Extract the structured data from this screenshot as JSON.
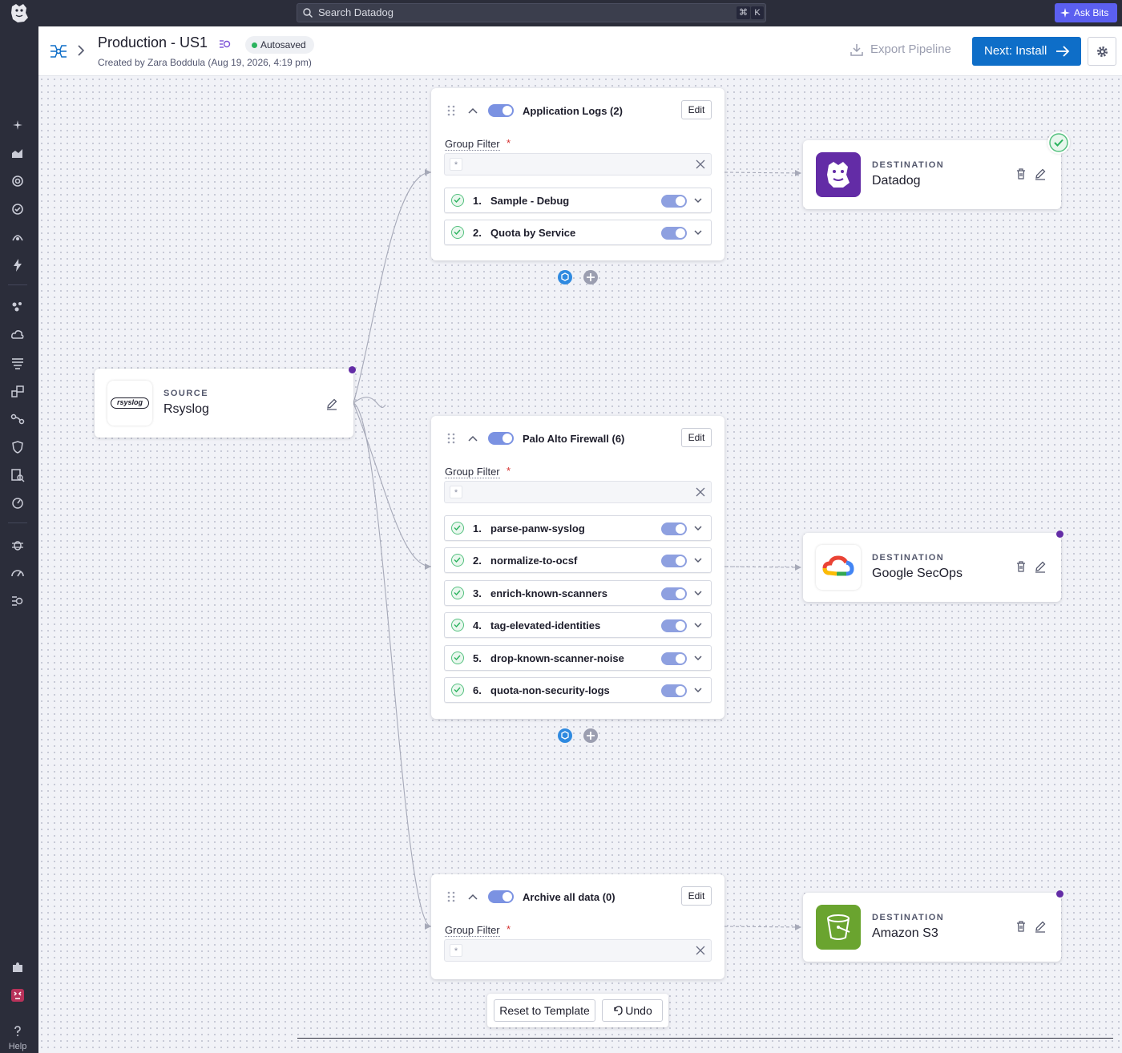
{
  "topbar": {
    "search_placeholder": "Search Datadog",
    "shortcut_cmd": "⌘",
    "shortcut_key": "K",
    "ask_bits": "Ask Bits"
  },
  "sidebar": {
    "help_label": "Help"
  },
  "header": {
    "title": "Production - US1",
    "status": "Autosaved",
    "created": "Created by Zara Boddula (Aug 19, 2026, 4:19 pm)",
    "export": "Export Pipeline",
    "next": "Next: Install"
  },
  "source": {
    "eyebrow": "SOURCE",
    "name": "Rsyslog",
    "logo_text": "rsyslog"
  },
  "groups": [
    {
      "title": "Application Logs (2)",
      "edit": "Edit",
      "filter_label": "Group Filter",
      "required": "*",
      "filter_value": "*",
      "processors": [
        {
          "num": "1.",
          "name": "Sample - Debug"
        },
        {
          "num": "2.",
          "name": "Quota by Service"
        }
      ]
    },
    {
      "title": "Palo Alto Firewall (6)",
      "edit": "Edit",
      "filter_label": "Group Filter",
      "required": "*",
      "filter_value": "*",
      "processors": [
        {
          "num": "1.",
          "name": "parse-panw-syslog"
        },
        {
          "num": "2.",
          "name": "normalize-to-ocsf"
        },
        {
          "num": "3.",
          "name": "enrich-known-scanners"
        },
        {
          "num": "4.",
          "name": "tag-elevated-identities"
        },
        {
          "num": "5.",
          "name": "drop-known-scanner-noise"
        },
        {
          "num": "6.",
          "name": "quota-non-security-logs"
        }
      ]
    },
    {
      "title": "Archive all data (0)",
      "edit": "Edit",
      "filter_label": "Group Filter",
      "required": "*",
      "filter_value": "*",
      "processors": []
    }
  ],
  "destinations": [
    {
      "eyebrow": "DESTINATION",
      "name": "Datadog",
      "icon": "datadog-logo",
      "brand_color": "#632ca6"
    },
    {
      "eyebrow": "DESTINATION",
      "name": "Google SecOps",
      "icon": "google-cloud-logo",
      "brand_color": "#4285f4"
    },
    {
      "eyebrow": "DESTINATION",
      "name": "Amazon S3",
      "icon": "s3-bucket-logo",
      "brand_color": "#6aa42f"
    }
  ],
  "footer": {
    "reset": "Reset to Template",
    "undo": "Undo"
  },
  "colors": {
    "accent": "#0e6ec8",
    "brand": "#632ca6",
    "toggle_on": "#8ea0e0",
    "success": "#2bb35e"
  }
}
